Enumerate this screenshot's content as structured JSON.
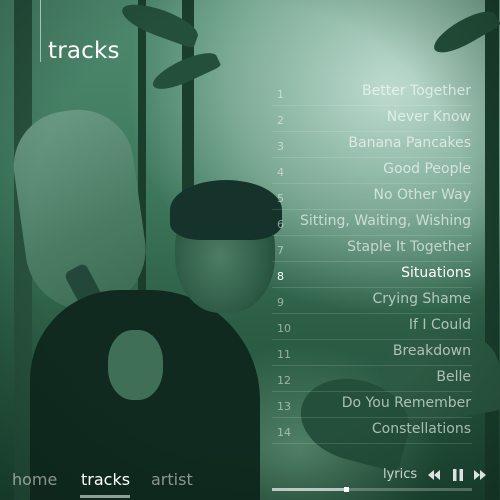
{
  "header": {
    "title": "tracks"
  },
  "tracks": [
    {
      "number": "1",
      "title": "Better Together"
    },
    {
      "number": "2",
      "title": "Never Know"
    },
    {
      "number": "3",
      "title": "Banana Pancakes"
    },
    {
      "number": "4",
      "title": "Good People"
    },
    {
      "number": "5",
      "title": "No Other Way"
    },
    {
      "number": "6",
      "title": "Sitting, Waiting, Wishing"
    },
    {
      "number": "7",
      "title": "Staple It Together"
    },
    {
      "number": "8",
      "title": "Situations"
    },
    {
      "number": "9",
      "title": "Crying Shame"
    },
    {
      "number": "10",
      "title": "If I Could"
    },
    {
      "number": "11",
      "title": "Breakdown"
    },
    {
      "number": "12",
      "title": "Belle"
    },
    {
      "number": "13",
      "title": "Do You Remember"
    },
    {
      "number": "14",
      "title": "Constellations"
    }
  ],
  "active_track_index": 7,
  "nav": {
    "items": [
      {
        "label": "home"
      },
      {
        "label": "tracks"
      },
      {
        "label": "artist"
      }
    ],
    "active": "tracks"
  },
  "player": {
    "lyrics_label": "lyrics",
    "progress": 0.37,
    "icons": {
      "prev": "rewind-icon",
      "pause": "pause-icon",
      "next": "fast-forward-icon"
    }
  },
  "colors": {
    "text_active": "#ffffff",
    "tint": "#2f5d48"
  }
}
